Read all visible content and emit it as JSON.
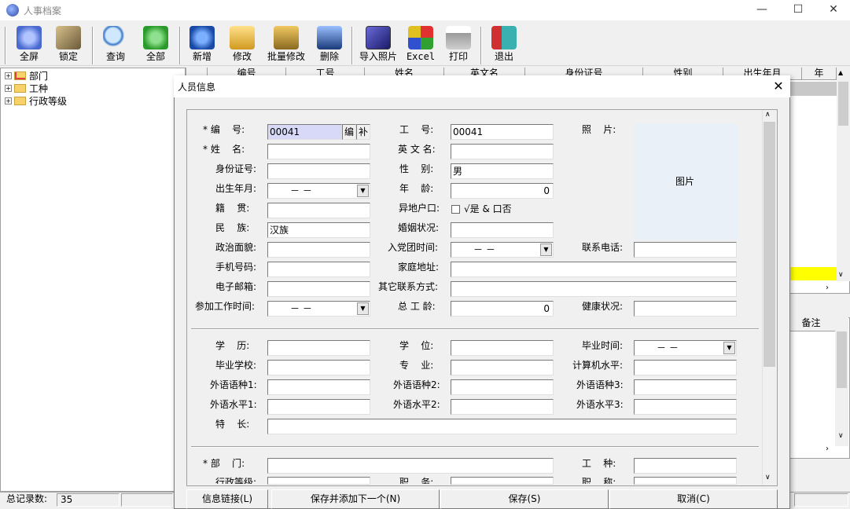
{
  "window": {
    "title": "人事档案",
    "minimize": "—",
    "maximize": "☐",
    "close": "✕"
  },
  "toolbar": [
    {
      "name": "fullscreen",
      "label": "全屏",
      "icon": "gear-icon",
      "color": "#6a8ad8"
    },
    {
      "name": "lock",
      "label": "锁定",
      "icon": "key-icon",
      "color": "#8a7a5a"
    },
    {
      "name": "query",
      "label": "查询",
      "icon": "magnifier-icon",
      "color": "#4a90c8"
    },
    {
      "name": "all",
      "label": "全部",
      "icon": "recycle-icon",
      "color": "#3aa83a"
    },
    {
      "name": "add",
      "label": "新增",
      "icon": "globe-icon",
      "color": "#2a6ac8"
    },
    {
      "name": "edit",
      "label": "修改",
      "icon": "folder-edit-icon",
      "color": "#d8a830"
    },
    {
      "name": "batch-edit",
      "label": "批量修改",
      "icon": "tools-icon",
      "color": "#c89830"
    },
    {
      "name": "delete",
      "label": "删除",
      "icon": "delete-icon",
      "color": "#2a5a9a"
    },
    {
      "name": "import-photo",
      "label": "导入照片",
      "icon": "photo-import-icon",
      "color": "#3a3aa8"
    },
    {
      "name": "excel",
      "label": "Excel",
      "icon": "excel-icon",
      "color": "#c83a3a"
    },
    {
      "name": "print",
      "label": "打印",
      "icon": "printer-icon",
      "color": "#9a9a9a"
    },
    {
      "name": "exit",
      "label": "退出",
      "icon": "exit-door-icon",
      "color": "#3a9a9a"
    }
  ],
  "tree": [
    {
      "label": "部门",
      "icon": "checked-folder-icon"
    },
    {
      "label": "工种",
      "icon": "folder-icon"
    },
    {
      "label": "行政等级",
      "icon": "folder-icon"
    }
  ],
  "grid": {
    "headers": [
      "编号",
      "工号",
      "姓名",
      "英文名",
      "身份证号",
      "性别",
      "出生年月",
      "年"
    ],
    "right_header": "备注",
    "highlight": "#ffff00"
  },
  "status": {
    "label": "总记录数:",
    "count": "35"
  },
  "dialog": {
    "title": "人员信息",
    "close": "✕",
    "photo_text": "图片",
    "checkbox_text": "√是  &  口否",
    "fields": [
      {
        "label": "* 编    号:",
        "value": "00041"
      },
      {
        "label": "工    号:",
        "value": "00041"
      },
      {
        "label": "照    片:",
        "value": ""
      },
      {
        "label": "* 姓    名:",
        "value": ""
      },
      {
        "label": "英 文 名:",
        "value": ""
      },
      {
        "label": "身份证号:",
        "value": ""
      },
      {
        "label": "性    别:",
        "value": "男"
      },
      {
        "label": "出生年月:",
        "value": "－  －"
      },
      {
        "label": "年    龄:",
        "value": "0"
      },
      {
        "label": "籍    贯:",
        "value": ""
      },
      {
        "label": "异地户口:",
        "value": ""
      },
      {
        "label": "民    族:",
        "value": "汉族"
      },
      {
        "label": "婚姻状况:",
        "value": ""
      },
      {
        "label": "政治面貌:",
        "value": ""
      },
      {
        "label": "入党团时间:",
        "value": "－  －"
      },
      {
        "label": "联系电话:",
        "value": ""
      },
      {
        "label": "手机号码:",
        "value": ""
      },
      {
        "label": "家庭地址:",
        "value": ""
      },
      {
        "label": "电子邮箱:",
        "value": ""
      },
      {
        "label": "其它联系方式:",
        "value": ""
      },
      {
        "label": "参加工作时间:",
        "value": "－  －"
      },
      {
        "label": "总 工 龄:",
        "value": "0"
      },
      {
        "label": "健康状况:",
        "value": ""
      },
      {
        "label": "学    历:",
        "value": ""
      },
      {
        "label": "学    位:",
        "value": ""
      },
      {
        "label": "毕业时间:",
        "value": "－  －"
      },
      {
        "label": "毕业学校:",
        "value": ""
      },
      {
        "label": "专    业:",
        "value": ""
      },
      {
        "label": "计算机水平:",
        "value": ""
      },
      {
        "label": "外语语种1:",
        "value": ""
      },
      {
        "label": "外语语种2:",
        "value": ""
      },
      {
        "label": "外语语种3:",
        "value": ""
      },
      {
        "label": "外语水平1:",
        "value": ""
      },
      {
        "label": "外语水平2:",
        "value": ""
      },
      {
        "label": "外语水平3:",
        "value": ""
      },
      {
        "label": "特    长:",
        "value": ""
      },
      {
        "label": "* 部    门:",
        "value": ""
      },
      {
        "label": "工    种:",
        "value": ""
      },
      {
        "label": "行政等级:",
        "value": ""
      },
      {
        "label": "职    务:",
        "value": ""
      },
      {
        "label": "职    称:",
        "value": ""
      }
    ],
    "code_buttons": [
      "编",
      "补"
    ],
    "buttons": [
      "信息链接(L)",
      "保存并添加下一个(N)",
      "保存(S)",
      "取消(C)"
    ]
  }
}
